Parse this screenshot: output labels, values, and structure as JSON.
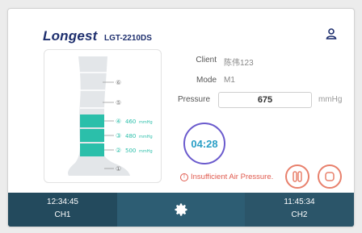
{
  "brand": {
    "name": "Longest",
    "model": "LGT-2210DS"
  },
  "leg": {
    "chambers": [
      {
        "num": "⑥",
        "pressure": "",
        "unit": ""
      },
      {
        "num": "⑤",
        "pressure": "",
        "unit": ""
      },
      {
        "num": "④",
        "pressure": "460",
        "unit": "mmHg"
      },
      {
        "num": "③",
        "pressure": "480",
        "unit": "mmHg"
      },
      {
        "num": "②",
        "pressure": "500",
        "unit": "mmHg"
      },
      {
        "num": "①",
        "pressure": "",
        "unit": ""
      }
    ]
  },
  "client": {
    "label": "Client",
    "value": "陈伟123"
  },
  "mode": {
    "label": "Mode",
    "value": "M1"
  },
  "pressure": {
    "label": "Pressure",
    "value": "675",
    "unit": "mmHg"
  },
  "timer": {
    "value": "04:28"
  },
  "warning": {
    "text": "Insufficient Air Pressure."
  },
  "channels": {
    "left": {
      "time": "12:34:45",
      "name": "CH1"
    },
    "right": {
      "time": "11:45:34",
      "name": "CH2"
    }
  },
  "colors": {
    "accent": "#2bbfaa",
    "bar": "#2d5d73",
    "warning": "#e05a4e",
    "timer_ring": "#6a5acd"
  }
}
